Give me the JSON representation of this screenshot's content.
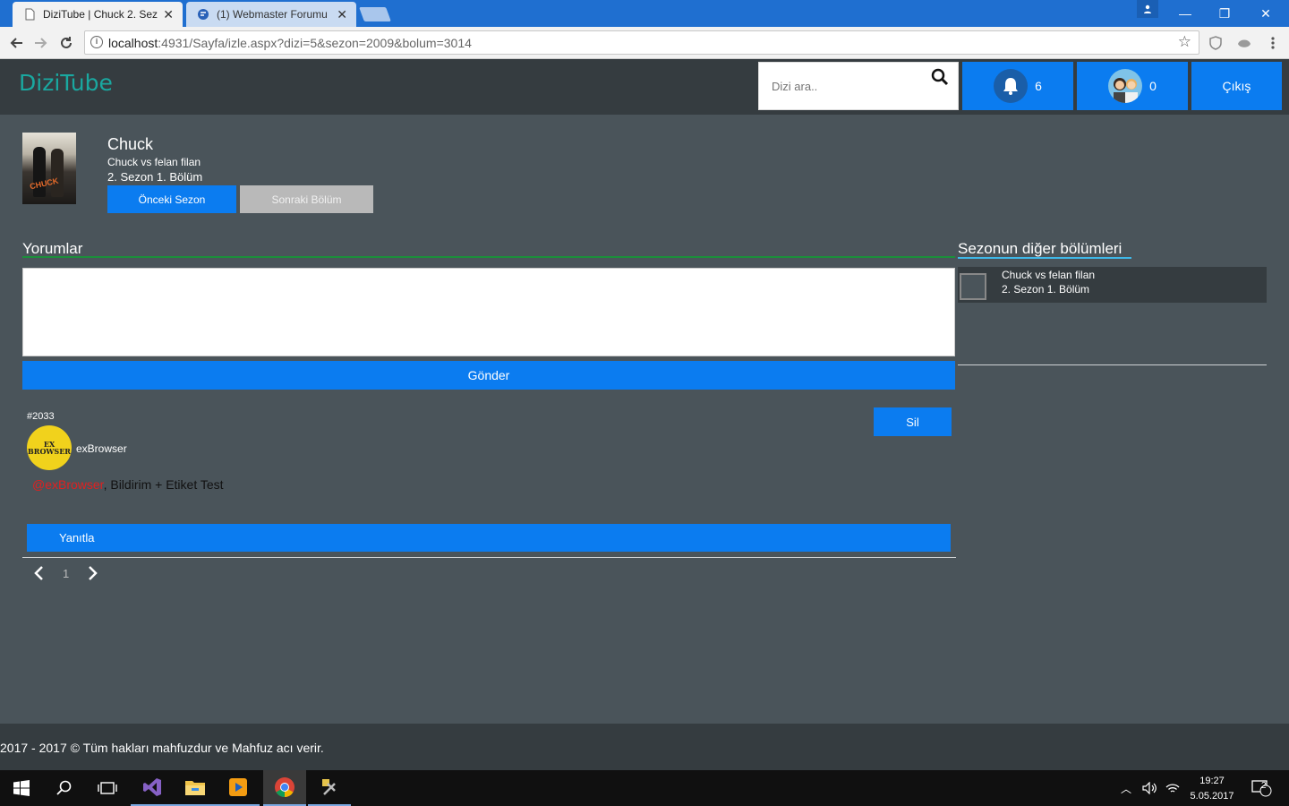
{
  "browser": {
    "tabs": [
      {
        "title": "DiziTube | Chuck 2. Sezon",
        "active": true
      },
      {
        "title": "(1) Webmaster Forumu |",
        "active": false
      }
    ],
    "url_host": "localhost",
    "url_path": ":4931/Sayfa/izle.aspx?dizi=5&sezon=2009&bolum=3014"
  },
  "header": {
    "logo": "DiziTube",
    "search_placeholder": "Dizi ara..",
    "notifications_count": "6",
    "friends_count": "0",
    "logout_label": "Çıkış"
  },
  "show": {
    "title": "Chuck",
    "episode_name": "Chuck vs felan filan",
    "episode_info": "2. Sezon 1. Bölüm",
    "prev_label": "Önceki Sezon",
    "next_label": "Sonraki Bölüm",
    "poster_text": "CHUCK"
  },
  "comments": {
    "title": "Yorumlar",
    "send_label": "Gönder",
    "items": [
      {
        "id": "#2033",
        "user": "exBrowser",
        "avatar_text": "EX BROWSER",
        "mention": "@exBrowser",
        "text": ", Bildirim + Etiket Test",
        "delete_label": "Sil",
        "reply_label": "Yanıtla"
      }
    ],
    "page": "1"
  },
  "sidebar": {
    "title": "Sezonun diğer bölümleri",
    "episodes": [
      {
        "name": "Chuck vs felan filan",
        "info": "2. Sezon 1. Bölüm"
      }
    ]
  },
  "footer": {
    "text": "2017 - 2017 © Tüm hakları mahfuzdur ve Mahfuz acı verir."
  },
  "taskbar": {
    "time": "19:27",
    "date": "5.05.2017",
    "notification_badge": "2"
  },
  "colors": {
    "brand": "#1aa8a0",
    "primary": "#0b7cf0",
    "page_bg": "#4a545a",
    "header_bg": "#353c40"
  }
}
